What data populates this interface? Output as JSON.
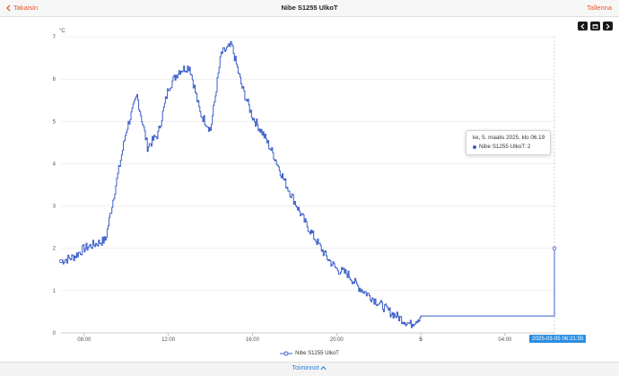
{
  "topbar": {
    "back_label": "Takaisin",
    "title": "Nibe S1255 UlkoT",
    "save_label": "Tallenna"
  },
  "bottombar": {
    "actions_label": "Toiminnot",
    "actions_icon": "chevron-up-icon"
  },
  "nav_buttons": [
    "chevron-left-icon",
    "calendar-icon",
    "chevron-right-icon"
  ],
  "colors": {
    "accent": "#e8552b",
    "series": "#3c5fc9",
    "link": "#2a7bd6",
    "badge": "#2a8ee0"
  },
  "tooltip": {
    "date": "ke, 5. maalis 2025, klo 06.19",
    "series_line": "Nibe S1255 UlkoT: 2"
  },
  "x_axis_badge": "2025-03-05 06:21:55",
  "chart_data": {
    "type": "line",
    "unit_label": "°C",
    "ylim": [
      0,
      7
    ],
    "y_ticks": [
      "0",
      "1",
      "2",
      "3",
      "4",
      "5",
      "6",
      "7"
    ],
    "x_ticks": [
      "08:00",
      "12:00",
      "16:00",
      "20:00",
      "5",
      "04:00"
    ],
    "grid": true,
    "legend": "bottom",
    "series": [
      {
        "name": "Nibe S1255 UlkoT",
        "x_hours": [
          6.9,
          7.5,
          8.0,
          8.5,
          9.0,
          9.5,
          10.0,
          10.5,
          11.0,
          11.5,
          12.0,
          12.5,
          13.0,
          13.5,
          14.0,
          14.5,
          15.0,
          15.5,
          16.0,
          16.5,
          17.0,
          17.5,
          18.0,
          18.5,
          19.0,
          19.5,
          20.0,
          20.5,
          21.0,
          21.5,
          22.0,
          22.5,
          23.0,
          23.5,
          24.0,
          30.35
        ],
        "values": [
          1.7,
          1.8,
          2.0,
          2.1,
          2.2,
          3.5,
          4.8,
          5.6,
          4.4,
          4.7,
          5.8,
          6.2,
          6.3,
          5.2,
          4.8,
          6.6,
          6.8,
          5.8,
          5.1,
          4.7,
          4.2,
          3.6,
          3.1,
          2.6,
          2.2,
          1.8,
          1.5,
          1.4,
          1.1,
          0.9,
          0.7,
          0.5,
          0.35,
          0.2,
          0.4,
          2.0
        ]
      }
    ]
  }
}
